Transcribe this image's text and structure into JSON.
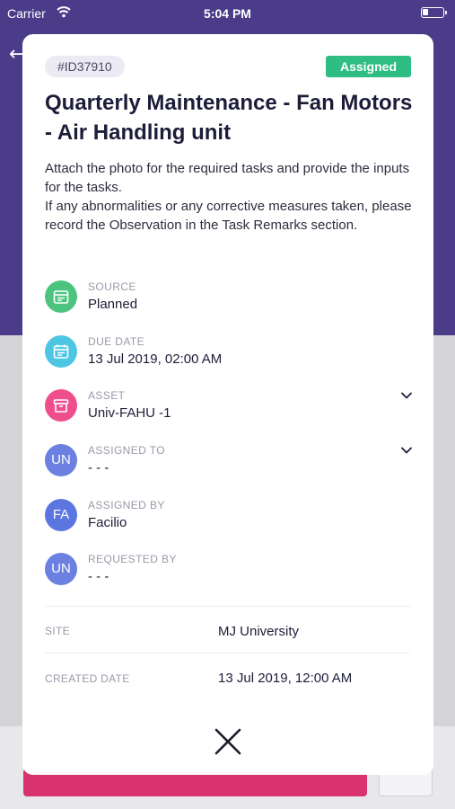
{
  "status_bar": {
    "carrier": "Carrier",
    "time": "5:04 PM"
  },
  "modal": {
    "id": "#ID37910",
    "status": "Assigned",
    "title": "Quarterly Maintenance - Fan Motors - Air Handling unit",
    "description": "Attach the photo for the required tasks and provide the inputs for the tasks.\nIf any abnormalities or any corrective measures taken, please record the Observation in the Task Remarks section.",
    "details": [
      {
        "label": "SOURCE",
        "value": "Planned",
        "icon": "calendar-icon",
        "color": "#4cc47f"
      },
      {
        "label": "DUE DATE",
        "value": "13 Jul 2019, 02:00 AM",
        "icon": "calendar-icon",
        "color": "#4ec6e3"
      },
      {
        "label": "ASSET",
        "value": "Univ-FAHU -1",
        "icon": "archive-box-icon",
        "color": "#ee4f8c"
      },
      {
        "label": "ASSIGNED TO",
        "value": "- - -",
        "initials": "UN",
        "color": "#6b80e0"
      },
      {
        "label": "ASSIGNED BY",
        "value": "Facilio",
        "initials": "FA",
        "color": "#5b76e0"
      },
      {
        "label": "REQUESTED BY",
        "value": "- - -",
        "initials": "UN",
        "color": "#6b80e0"
      }
    ],
    "meta": [
      {
        "label": "SITE",
        "value": "MJ University"
      },
      {
        "label": "CREATED DATE",
        "value": "13 Jul 2019, 12:00 AM"
      }
    ]
  },
  "colors": {
    "header_purple": "#4b3c8a",
    "status_green": "#2ebd82",
    "primary_pink": "#d8336d",
    "title_text": "#1d1d3a"
  }
}
